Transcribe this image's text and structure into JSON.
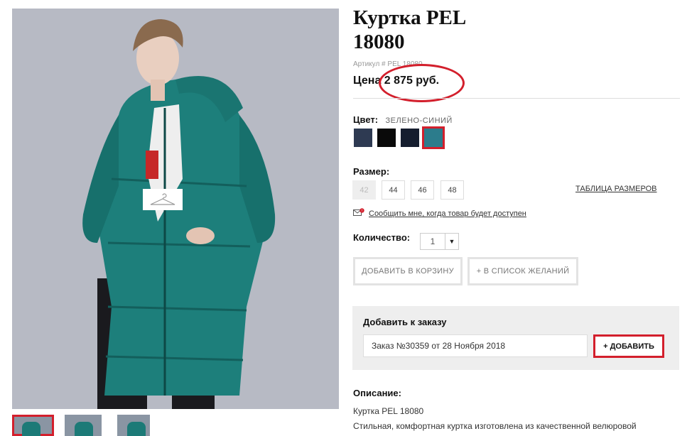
{
  "product": {
    "title_line1": "Куртка PEL",
    "title_line2": "18080",
    "sku_label": "Артикул # PEL 18080",
    "price_label": "Цена",
    "price_value": "2 875 руб."
  },
  "color": {
    "label": "Цвет:",
    "selected_name": "ЗЕЛЕНО-СИНИЙ",
    "swatches": [
      "#2e3a52",
      "#0a0a0a",
      "#151d2e",
      "#2c7c8c"
    ]
  },
  "sizes": {
    "label": "Размер:",
    "options": [
      "42",
      "44",
      "46",
      "48"
    ],
    "disabled": [
      "42"
    ],
    "size_table_link": "ТАБЛИЦА РАЗМЕРОВ",
    "notify_link": "Сообщить мне, когда товар будет доступен"
  },
  "quantity": {
    "label": "Количество:",
    "value": "1"
  },
  "buttons": {
    "add_to_cart": "ДОБАВИТЬ В КОРЗИНУ",
    "wishlist": "+ В СПИСОК ЖЕЛАНИЙ"
  },
  "order_box": {
    "title": "Добавить к заказу",
    "selected_order": "Заказ №30359 от 28 Ноября 2018",
    "add_button": "+ ДОБАВИТЬ"
  },
  "description": {
    "label": "Описание:",
    "line1": "Куртка PEL 18080",
    "line2": "Стильная, комфортная куртка изготовлена из качественной велюровой"
  },
  "colors": {
    "accent_red": "#d31f2c",
    "coat_teal": "#1c7a77"
  }
}
